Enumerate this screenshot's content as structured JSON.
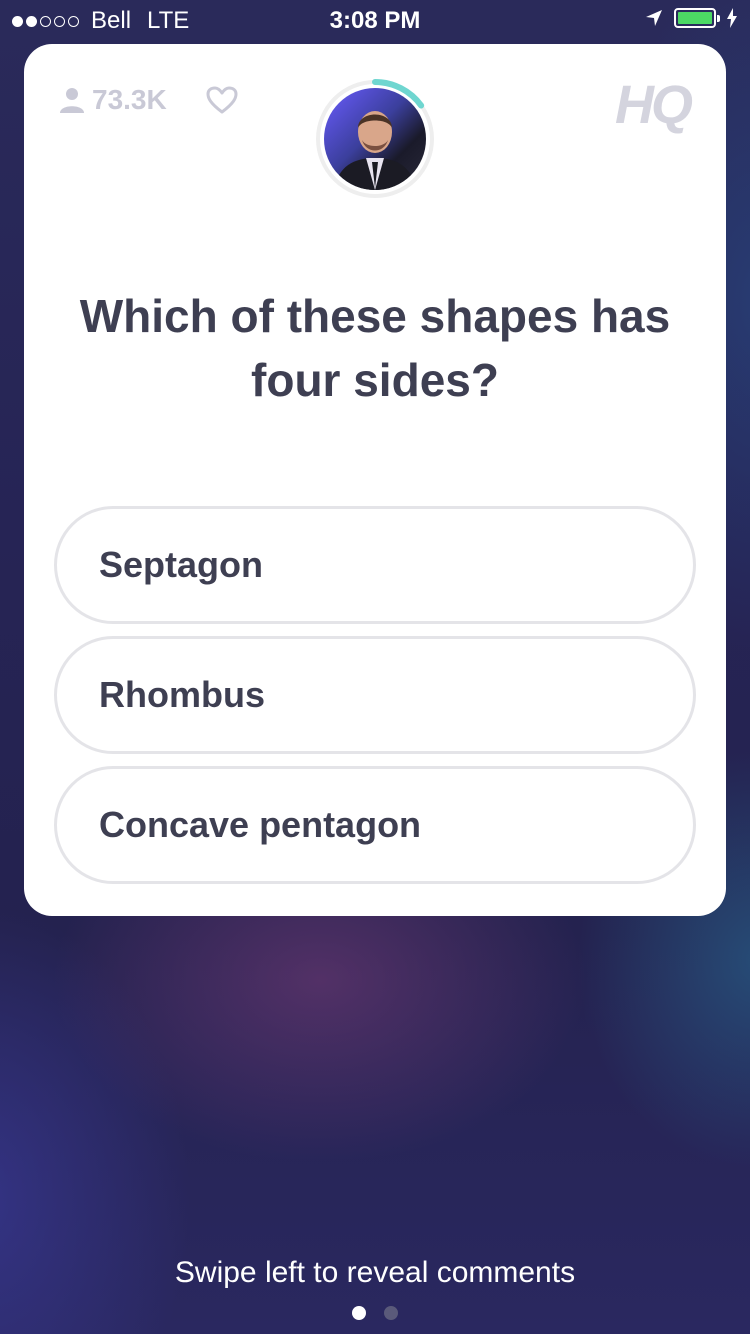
{
  "status_bar": {
    "carrier": "Bell",
    "network": "LTE",
    "time": "3:08 PM",
    "signal_bars_filled": 2,
    "signal_bars_total": 5,
    "battery_level": 1.0,
    "battery_color": "#4cd964"
  },
  "card": {
    "viewer_count": "73.3K",
    "logo_text": "HQ",
    "timer_progress": 0.15,
    "timer_color": "#6fd6d0",
    "question": "Which of these shapes has four sides?",
    "answers": [
      {
        "label": "Septagon"
      },
      {
        "label": "Rhombus"
      },
      {
        "label": "Concave pentagon"
      }
    ]
  },
  "footer": {
    "swipe_hint": "Swipe left to reveal comments",
    "page_count": 2,
    "active_page": 1
  },
  "icons": [
    "user-icon",
    "heart-icon",
    "location-arrow-icon",
    "battery-icon",
    "charging-bolt-icon"
  ]
}
